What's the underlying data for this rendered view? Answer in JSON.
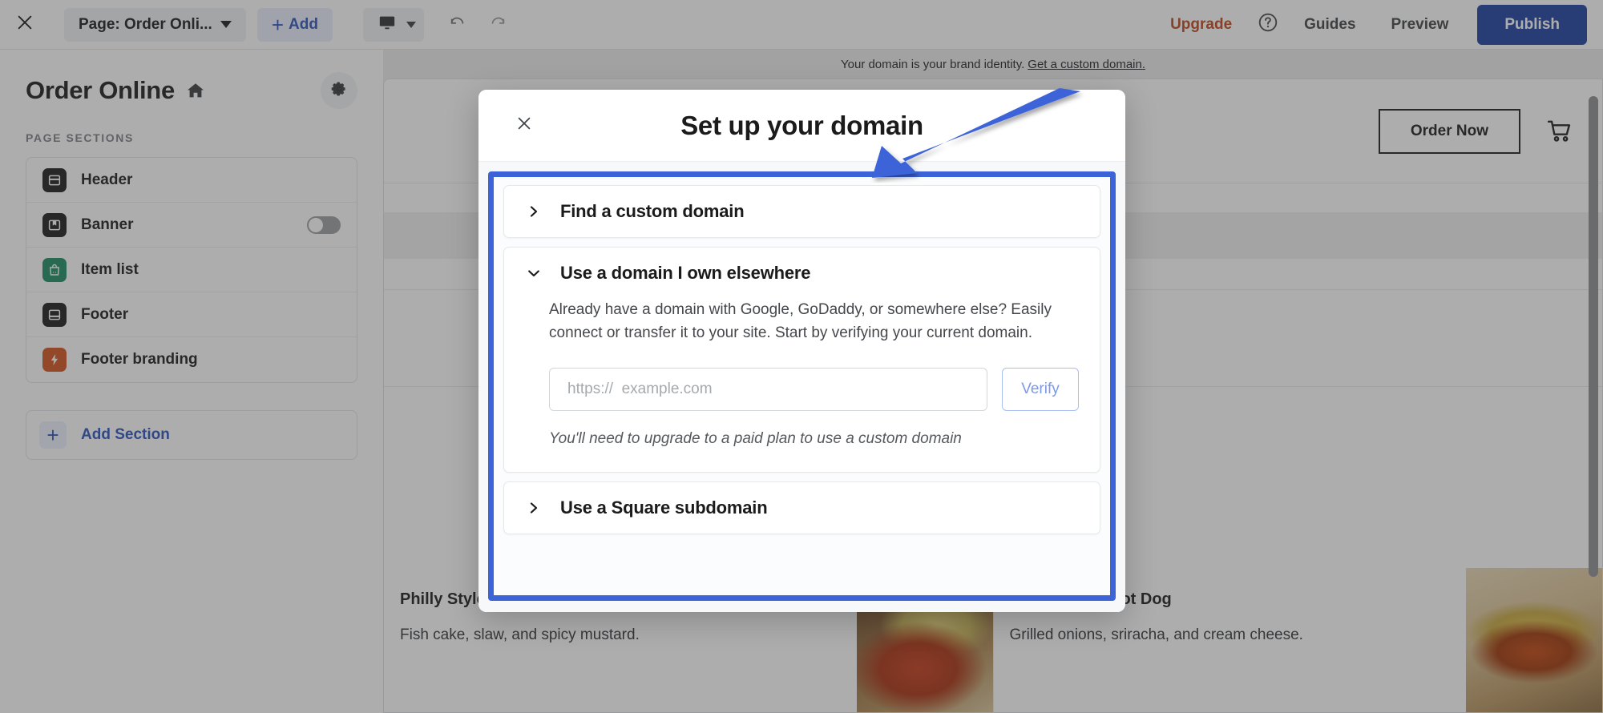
{
  "toolbar": {
    "close_icon": "close-icon",
    "page_selector_label": "Page: Order Onli...",
    "add_label": "Add",
    "device_icon": "desktop-icon",
    "undo_icon": "undo-icon",
    "redo_icon": "redo-icon",
    "upgrade_label": "Upgrade",
    "help_icon": "help-circle-icon",
    "guides_label": "Guides",
    "preview_label": "Preview",
    "publish_label": "Publish",
    "publish_color": "#1b3fa0",
    "upgrade_color": "#bf451d"
  },
  "sidebar": {
    "title": "Order Online",
    "home_icon": "home-icon",
    "settings_icon": "gear-icon",
    "kicker": "PAGE SECTIONS",
    "items": [
      {
        "label": "Header",
        "icon": "header-layout-icon",
        "icon_bg": "#1b1b1b",
        "has_toggle": false
      },
      {
        "label": "Banner",
        "icon": "banner-bookmark-icon",
        "icon_bg": "#1b1b1b",
        "has_toggle": true,
        "toggle_on": false
      },
      {
        "label": "Item list",
        "icon": "shopping-bag-icon",
        "icon_bg": "#1b8a62",
        "has_toggle": false
      },
      {
        "label": "Footer",
        "icon": "footer-layout-icon",
        "icon_bg": "#1b1b1b",
        "has_toggle": false
      },
      {
        "label": "Footer branding",
        "icon": "lightning-bolt-icon",
        "icon_bg": "#d4511e",
        "has_toggle": false
      }
    ],
    "add_section_label": "Add Section",
    "add_section_icon": "plus-icon"
  },
  "canvas": {
    "promo_text": "Your domain is your brand identity.",
    "promo_link": "Get a custom domain.",
    "order_now_label": "Order Now",
    "cart_icon": "shopping-cart-icon",
    "menu_items": [
      {
        "title": "Philly Style Hot Dog",
        "desc": "Fish cake, slaw, and spicy mustard."
      },
      {
        "title": "Seattle Style Hot Dog",
        "desc": "Grilled onions, sriracha, and cream cheese."
      }
    ]
  },
  "modal": {
    "close_icon": "close-icon",
    "title": "Set up your domain",
    "focus_border_color": "#3d63d8",
    "sections": [
      {
        "title": "Find a custom domain",
        "expanded": false,
        "chevron_icon": "chevron-right-icon"
      },
      {
        "title": "Use a domain I own elsewhere",
        "expanded": true,
        "chevron_icon": "chevron-down-icon",
        "description": "Already have a domain with Google, GoDaddy, or somewhere else? Easily connect or transfer it to your site. Start by verifying your current domain.",
        "input_placeholder": "https://  example.com",
        "input_value": "",
        "verify_label": "Verify",
        "note": "You'll need to upgrade to a paid plan to use a custom domain"
      },
      {
        "title": "Use a Square subdomain",
        "expanded": false,
        "chevron_icon": "chevron-right-icon"
      }
    ]
  },
  "annotation": {
    "arrow_color": "#3d63d8",
    "arrow_icon": "pointer-arrow"
  }
}
